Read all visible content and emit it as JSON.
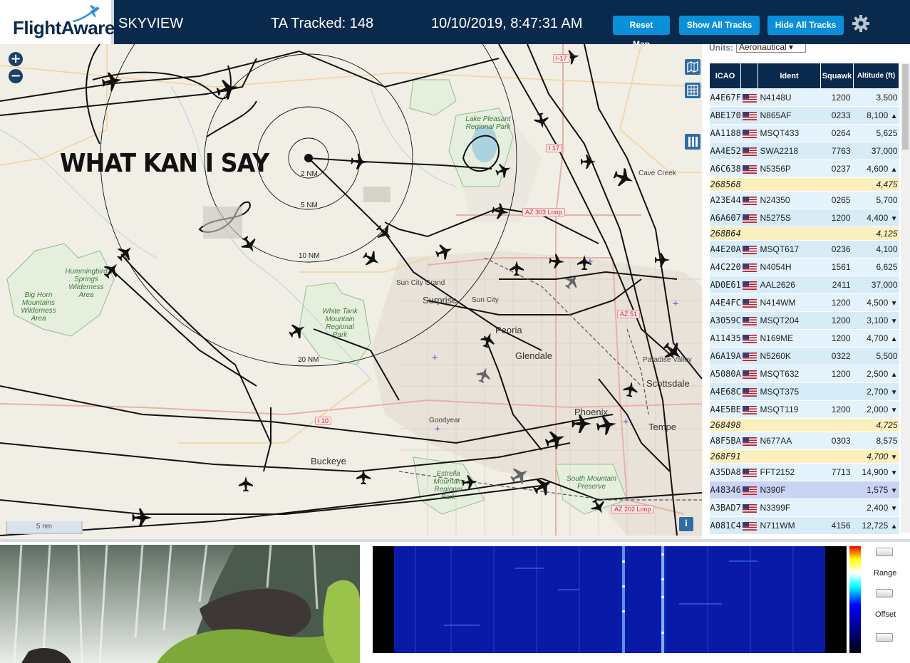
{
  "header": {
    "logo_text": "FlightAware",
    "app_title": "SKYVIEW",
    "ta_tracked": "TA Tracked: 148",
    "datetime": "10/10/2019, 8:47:31 AM",
    "buttons": {
      "reset_map": "Reset Map",
      "show_all_tracks": "Show All Tracks",
      "hide_all_tracks": "Hide All Tracks"
    },
    "settings_icon": "gear-icon"
  },
  "map": {
    "overlay_text": "WHAT KAN I SAY",
    "scale_label": "5 nm",
    "zoom_in": "+",
    "zoom_out": "−",
    "info": "i",
    "range_rings": [
      "2 NM",
      "5 NM",
      "10 NM",
      "20 NM"
    ],
    "cities": [
      "Surprise",
      "Peoria",
      "Glendale",
      "Scottsdale",
      "Phoenix",
      "Tempe",
      "Buckeye",
      "Goodyear"
    ],
    "small_places": [
      "Sun City Grand",
      "Sun City",
      "Cave Creek",
      "Paradise Valley"
    ],
    "parks": [
      "Lake Pleasant Regional Park",
      "Hummingbird Springs Wilderness Area",
      "Big Horn Mountains Wilderness Area",
      "White Tank Mountain Regional Park",
      "Estrella Mountain Regional Park",
      "South Mountain Preserve"
    ],
    "roads": [
      "I-17",
      "I 17",
      "AZ 303 Loop",
      "I 10",
      "AZ 202 Loop",
      "AZ 51"
    ],
    "colors": {
      "land": "#f1eee6",
      "track": "#111111",
      "park_outline": "#7fb07f",
      "urban": "#e6dfd5"
    }
  },
  "panel": {
    "units_label": "Units:",
    "units_value": "Aeronautical ▾",
    "columns": [
      "ICAO",
      "",
      "Ident",
      "Squawk",
      "Altitude (ft)"
    ],
    "rows": [
      {
        "icao": "A4E67F",
        "flag": true,
        "ident": "N4148U",
        "squawk": "1200",
        "alt": "3,500",
        "trend": ""
      },
      {
        "icao": "ABE170",
        "flag": true,
        "ident": "N865AF",
        "squawk": "0233",
        "alt": "8,100",
        "trend": "▲"
      },
      {
        "icao": "AA1188",
        "flag": true,
        "ident": "MSQT433",
        "squawk": "0264",
        "alt": "5,625",
        "trend": ""
      },
      {
        "icao": "AA4E52",
        "flag": true,
        "ident": "SWA2218",
        "squawk": "7763",
        "alt": "37,000",
        "trend": ""
      },
      {
        "icao": "A6C638",
        "flag": true,
        "ident": "N5356P",
        "squawk": "0237",
        "alt": "4,600",
        "trend": "▲"
      },
      {
        "icao": "268568",
        "flag": false,
        "ident": "",
        "squawk": "",
        "alt": "4,475",
        "trend": "",
        "mlat": true
      },
      {
        "icao": "A23E44",
        "flag": true,
        "ident": "N24350",
        "squawk": "0265",
        "alt": "5,700",
        "trend": ""
      },
      {
        "icao": "A6A607",
        "flag": true,
        "ident": "N5275S",
        "squawk": "1200",
        "alt": "4,400",
        "trend": "▼"
      },
      {
        "icao": "268B64",
        "flag": false,
        "ident": "",
        "squawk": "",
        "alt": "4,125",
        "trend": "",
        "mlat": true
      },
      {
        "icao": "A4E20A",
        "flag": true,
        "ident": "MSQT617",
        "squawk": "0236",
        "alt": "4,100",
        "trend": ""
      },
      {
        "icao": "A4C220",
        "flag": true,
        "ident": "N4054H",
        "squawk": "1561",
        "alt": "6,625",
        "trend": ""
      },
      {
        "icao": "AD0E61",
        "flag": true,
        "ident": "AAL2626",
        "squawk": "2411",
        "alt": "37,000",
        "trend": ""
      },
      {
        "icao": "A4E4FC",
        "flag": true,
        "ident": "N414WM",
        "squawk": "1200",
        "alt": "4,500",
        "trend": "▼"
      },
      {
        "icao": "A3059C",
        "flag": true,
        "ident": "MSQT204",
        "squawk": "1200",
        "alt": "3,100",
        "trend": "▼"
      },
      {
        "icao": "A11435",
        "flag": true,
        "ident": "N169ME",
        "squawk": "1200",
        "alt": "4,700",
        "trend": "▲"
      },
      {
        "icao": "A6A19A",
        "flag": true,
        "ident": "N5260K",
        "squawk": "0322",
        "alt": "5,500",
        "trend": ""
      },
      {
        "icao": "A5080A",
        "flag": true,
        "ident": "MSQT632",
        "squawk": "1200",
        "alt": "2,500",
        "trend": "▲"
      },
      {
        "icao": "A4E68C",
        "flag": true,
        "ident": "MSQT375",
        "squawk": "",
        "alt": "2,700",
        "trend": "▼"
      },
      {
        "icao": "A4E5BE",
        "flag": true,
        "ident": "MSQT119",
        "squawk": "1200",
        "alt": "2,000",
        "trend": "▼"
      },
      {
        "icao": "268498",
        "flag": false,
        "ident": "",
        "squawk": "",
        "alt": "4,725",
        "trend": "",
        "mlat": true
      },
      {
        "icao": "A8F5BA",
        "flag": true,
        "ident": "N677AA",
        "squawk": "0303",
        "alt": "8,575",
        "trend": ""
      },
      {
        "icao": "268F91",
        "flag": false,
        "ident": "",
        "squawk": "",
        "alt": "4,700",
        "trend": "▼",
        "mlat": true
      },
      {
        "icao": "A35DA8",
        "flag": true,
        "ident": "FFT2152",
        "squawk": "7713",
        "alt": "14,900",
        "trend": "▼"
      },
      {
        "icao": "A48346",
        "flag": true,
        "ident": "N390F",
        "squawk": "",
        "alt": "1,575",
        "trend": "▼",
        "selected": true
      },
      {
        "icao": "A3BAD7",
        "flag": true,
        "ident": "N3399F",
        "squawk": "",
        "alt": "2,400",
        "trend": "▼"
      },
      {
        "icao": "A081C4",
        "flag": true,
        "ident": "N711WM",
        "squawk": "4156",
        "alt": "12,725",
        "trend": "▲"
      }
    ]
  },
  "bottom": {
    "range_label": "Range",
    "offset_label": "Offset"
  }
}
